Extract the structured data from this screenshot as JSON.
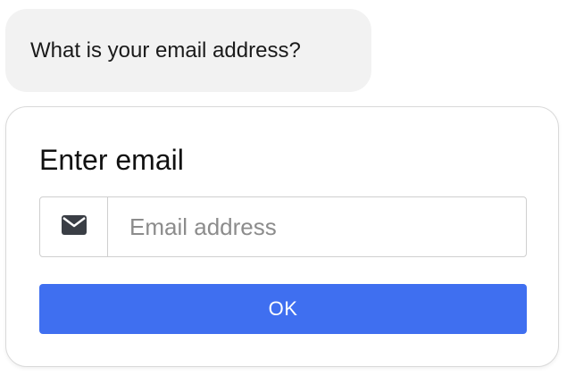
{
  "chat": {
    "question": "What is your email address?"
  },
  "form": {
    "title": "Enter email",
    "email_input": {
      "value": "",
      "placeholder": "Email address",
      "icon": "envelope-icon"
    },
    "submit_label": "OK"
  },
  "colors": {
    "bubble_bg": "#f2f2f2",
    "button_bg": "#3f6ff0",
    "button_text": "#ffffff",
    "border": "#cfcfcf"
  }
}
